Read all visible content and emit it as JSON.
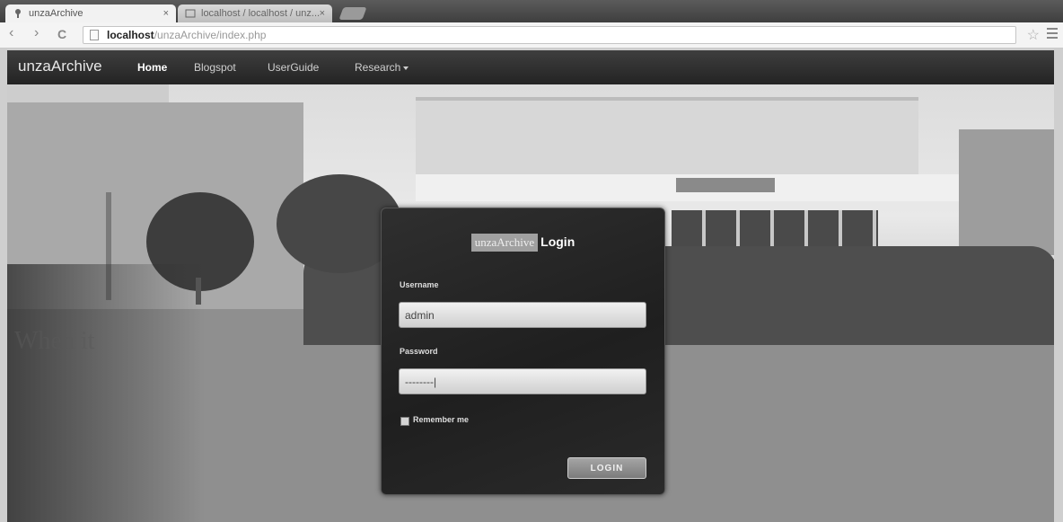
{
  "browser": {
    "tabs": [
      {
        "title": "unzaArchive"
      },
      {
        "title": "localhost / localhost / unz..."
      }
    ],
    "tab_close": "×",
    "url_host": "localhost",
    "url_path": "/unzaArchive/index.php",
    "back": "‹",
    "forward": "›",
    "reload": "C",
    "star": "☆"
  },
  "navbar": {
    "brand": "unzaArchive",
    "items": [
      {
        "label": "Home"
      },
      {
        "label": "Blogspot"
      },
      {
        "label": "UserGuide"
      },
      {
        "label": "Research"
      }
    ]
  },
  "background_text": "When it",
  "login": {
    "title_brand": "unzaArchive",
    "title_word": "Login",
    "username_label": "Username",
    "username_value": "admin",
    "password_label": "Password",
    "password_value": "--------|",
    "remember_label": "Remember me",
    "button_label": "LOGIN"
  }
}
